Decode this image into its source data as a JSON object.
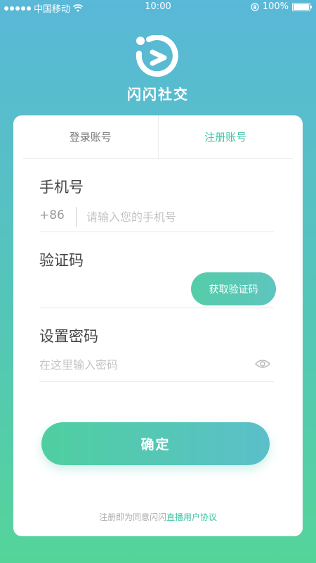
{
  "status_bar": {
    "carrier": "中国移动",
    "time": "10:00",
    "battery": "100%"
  },
  "app": {
    "name": "闪闪社交"
  },
  "tabs": [
    {
      "label": "登录账号",
      "active": false
    },
    {
      "label": "注册账号",
      "active": true
    }
  ],
  "form": {
    "phone": {
      "label": "手机号",
      "country_code": "+86",
      "placeholder": "请输入您的手机号",
      "value": ""
    },
    "code": {
      "label": "验证码",
      "button_label": "获取验证码",
      "value": ""
    },
    "password": {
      "label": "设置密码",
      "placeholder": "在这里输入密码",
      "value": ""
    },
    "submit_label": "确定"
  },
  "agreement": {
    "prefix": "注册即为同意闪闪",
    "link": "直播用户协议"
  },
  "colors": {
    "accent": "#3ec4a4",
    "background_top": "#5ab8d8",
    "background_bottom": "#55d49a"
  }
}
